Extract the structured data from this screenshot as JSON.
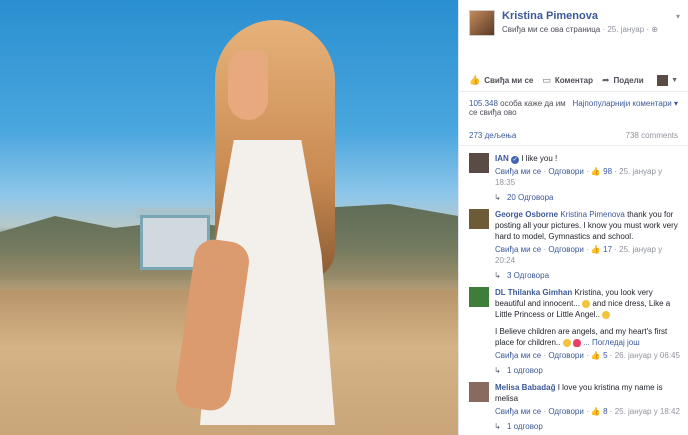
{
  "post": {
    "page_name": "Kristina Pimenova",
    "liked_label": "Свиђа ми се ова страница",
    "date": "25. јануар"
  },
  "actions": {
    "like": "Свиђа ми се",
    "comment": "Коментар",
    "share": "Подели"
  },
  "stats": {
    "likes_count": "105.348",
    "likes_text": "особа каже да им се свиђа ово",
    "sort_label": "Најпопуларнији коментари",
    "shares": "273 дељења",
    "comments": "738 comments"
  },
  "ui_strings": {
    "like": "Свиђа ми се",
    "reply": "Одговори",
    "see_more": "Погледај још"
  },
  "comments": [
    {
      "name": "IAN",
      "text": "I like you !",
      "likes": "98",
      "date": "25. јануар у 18:35",
      "replies": "20 Одговора",
      "avatar_color": "#5a4b45"
    },
    {
      "name": "George Osborne",
      "mention": "Kristina Pimenova",
      "text": "thank you for posting all your pictures. I know you must work very hard to model, Gymnastics and school.",
      "likes": "17",
      "date": "25. јануар у 20:24",
      "replies": "3 Одговора",
      "avatar_color": "#6d5a36"
    },
    {
      "name": "DL Thilanka Gimhan",
      "text": "Kristina, you look very beautiful and innocent...",
      "text2": "and nice dress, Like a Little Princess or Little Angel..",
      "text3": "I Believe children are angels, and my heart's first place for children..",
      "likes": "5",
      "date": "26. јануар у 06:45",
      "replies": "1 одговор",
      "avatar_color": "#3e7d3a"
    },
    {
      "name": "Melisa Babadağ",
      "text": "I love you kristina my name is melisa",
      "likes": "8",
      "date": "25. јануар у 18:42",
      "replies": "1 одговор",
      "avatar_color": "#8a6a5e"
    }
  ]
}
